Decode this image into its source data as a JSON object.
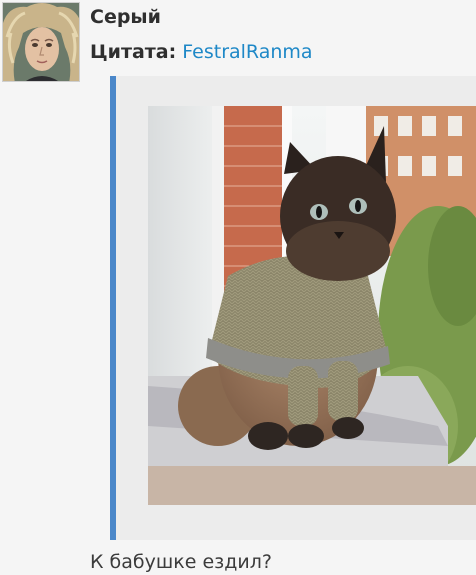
{
  "post": {
    "username": "Серый",
    "quote_label": "Цитата:",
    "quote_author": "FestralRanma",
    "reply_text": "К бабушке ездил?"
  },
  "colors": {
    "page_bg": "#f5f5f5",
    "quote_bg": "#ececec",
    "quote_border": "#4a87c9",
    "link": "#1e88c7"
  },
  "images": {
    "avatar": "avatar-icon",
    "photo": "cat-in-sweater-photo"
  }
}
